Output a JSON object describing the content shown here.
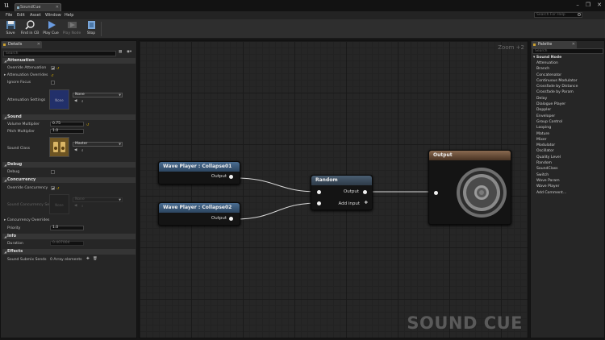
{
  "window": {
    "tab_label": "SoundCue",
    "controls": [
      "–",
      "❐",
      "✕"
    ]
  },
  "menu": [
    "File",
    "Edit",
    "Asset",
    "Window",
    "Help"
  ],
  "search_help": {
    "placeholder": "Search For Help"
  },
  "toolbar": {
    "buttons": [
      {
        "label": "Save",
        "icon": "save-icon",
        "enabled": true
      },
      {
        "label": "Find in CB",
        "icon": "find-in-content-browser-icon",
        "enabled": true
      },
      {
        "label": "Play Cue",
        "icon": "play-icon",
        "enabled": true
      },
      {
        "label": "Play Node",
        "icon": "play-node-icon",
        "enabled": false
      },
      {
        "label": "Stop",
        "icon": "stop-icon",
        "enabled": true
      }
    ]
  },
  "details": {
    "tab_label": "Details",
    "search_placeholder": "Search",
    "sections": {
      "attenuation": "Attenuation",
      "sound": "Sound",
      "debug": "Debug",
      "concurrency": "Concurrency",
      "info": "Info",
      "effects": "Effects"
    },
    "props": {
      "override_attenuation": "Override Attenuation",
      "attenuation_overrides": "Attenuation Overrides",
      "ignore_focus": "Ignore Focus",
      "attenuation_settings": "Attenuation Settings",
      "attenuation_asset": "None",
      "attenuation_thumb": "None",
      "volume_multiplier": "Volume Multiplier",
      "volume_value": "0.75",
      "pitch_multiplier": "Pitch Multiplier",
      "pitch_value": "1.0",
      "sound_class": "Sound Class",
      "sound_class_value": "Master",
      "debug": "Debug",
      "override_concurrency": "Override Concurrency",
      "sound_concurrency_settings": "Sound Concurrency Sett",
      "concurrency_asset": "None",
      "concurrency_thumb": "None",
      "concurrency_overrides": "Concurrency Overrides",
      "priority": "Priority",
      "priority_value": "1.0",
      "duration": "Duration",
      "duration_value": "0.407004",
      "sound_submix_sends": "Sound Submix Sends",
      "submix_value": "0 Array elements"
    }
  },
  "graph": {
    "zoom": "Zoom +2",
    "watermark": "SOUND CUE",
    "nodes": {
      "wave1": {
        "title": "Wave Player : Collapse01",
        "output": "Output"
      },
      "wave2": {
        "title": "Wave Player : Collapse02",
        "output": "Output"
      },
      "random": {
        "title": "Random",
        "output": "Output",
        "add_input": "Add input"
      },
      "output": {
        "title": "Output"
      }
    },
    "colors": {
      "wave_header": "#3d5a78",
      "random_header": "#3c4d5e",
      "output_header": "#6e5540"
    }
  },
  "palette": {
    "tab_label": "Palette",
    "search_placeholder": "Search",
    "category": "▾ Sound Node",
    "items": [
      "Attenuation",
      "Branch",
      "Concatenator",
      "Continuous Modulator",
      "Crossfade by Distance",
      "Crossfade by Param",
      "Delay",
      "Dialogue Player",
      "Doppler",
      "Enveloper",
      "Group Control",
      "Looping",
      "Mature",
      "Mixer",
      "Modulator",
      "Oscillator",
      "Quality Level",
      "Random",
      "SoundClass",
      "Switch",
      "Wave Param",
      "Wave Player",
      "Add Comment..."
    ]
  }
}
